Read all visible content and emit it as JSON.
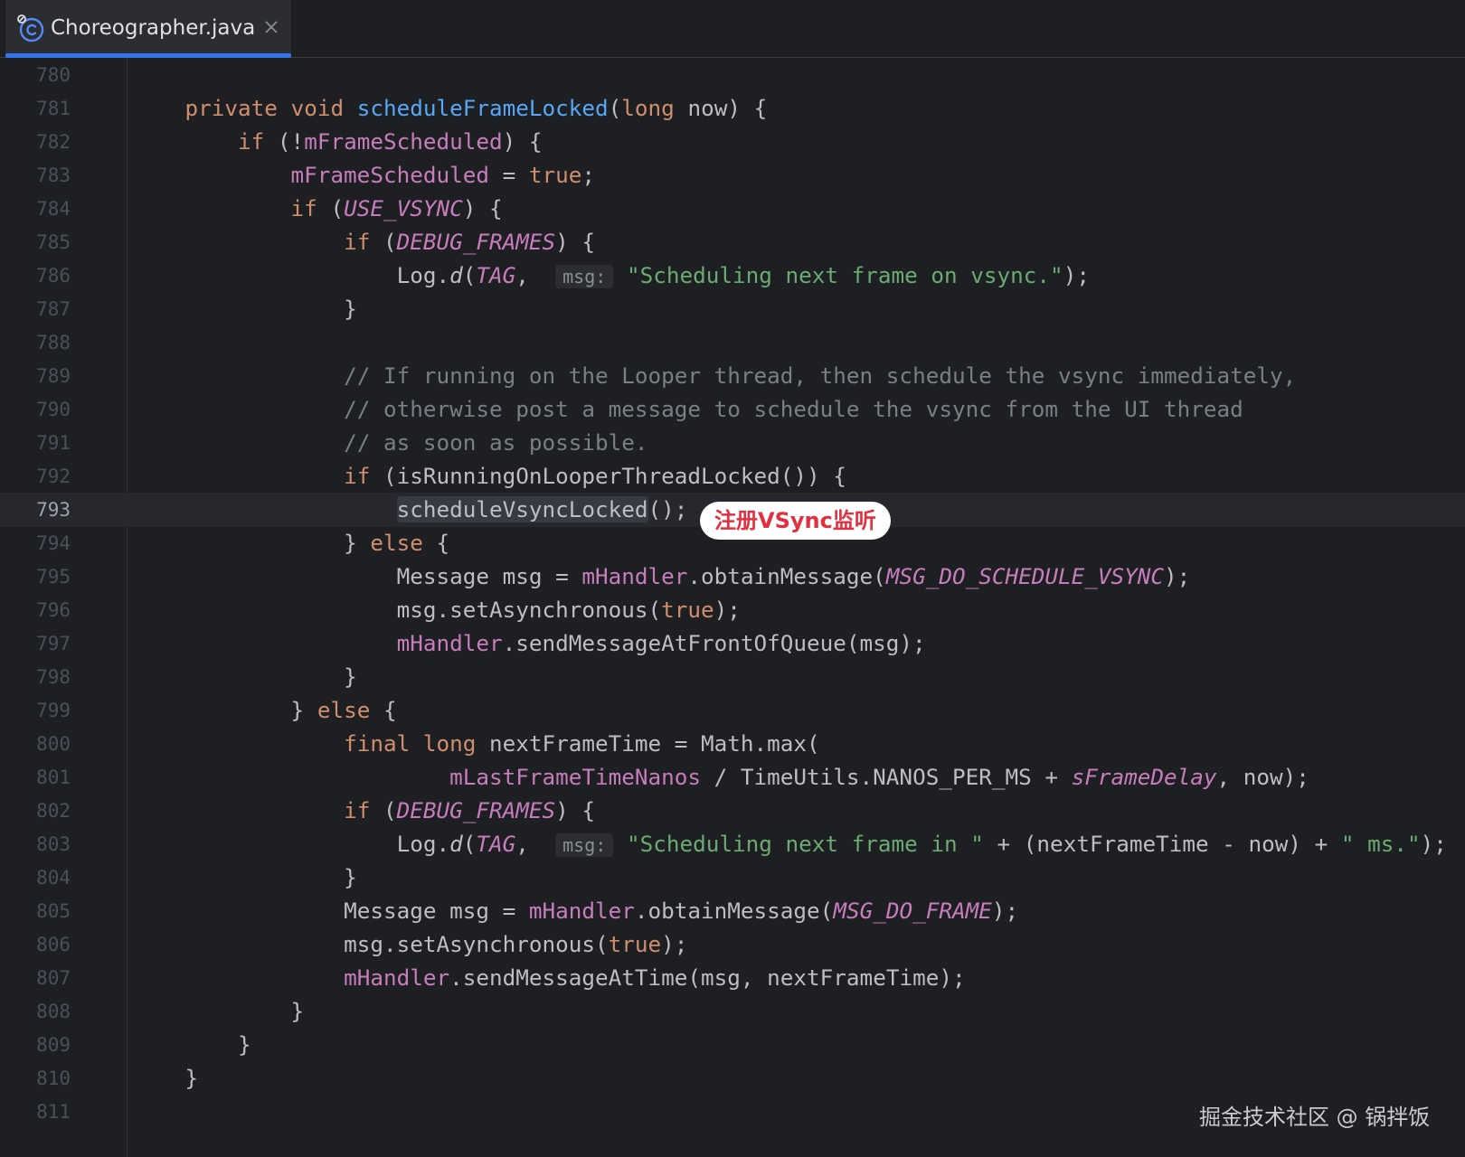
{
  "tab": {
    "title": "Choreographer.java",
    "icon": "java-class-icon",
    "close_icon": "close-icon",
    "active_color": "#3574f0"
  },
  "editor": {
    "current_line": "793",
    "lines": [
      {
        "num": "780",
        "indent": "",
        "tokens": []
      },
      {
        "num": "781",
        "indent": "    ",
        "tokens": [
          {
            "t": "private",
            "c": "kw"
          },
          {
            "t": " "
          },
          {
            "t": "void",
            "c": "kw"
          },
          {
            "t": " "
          },
          {
            "t": "scheduleFrameLocked",
            "c": "fn"
          },
          {
            "t": "("
          },
          {
            "t": "long",
            "c": "kw"
          },
          {
            "t": " now) {"
          }
        ]
      },
      {
        "num": "782",
        "indent": "        ",
        "tokens": [
          {
            "t": "if",
            "c": "kw"
          },
          {
            "t": " (!"
          },
          {
            "t": "mFrameScheduled",
            "c": "field"
          },
          {
            "t": ") {"
          }
        ]
      },
      {
        "num": "783",
        "indent": "            ",
        "tokens": [
          {
            "t": "mFrameScheduled",
            "c": "field"
          },
          {
            "t": " = "
          },
          {
            "t": "true",
            "c": "kw"
          },
          {
            "t": ";"
          }
        ]
      },
      {
        "num": "784",
        "indent": "            ",
        "tokens": [
          {
            "t": "if",
            "c": "kw"
          },
          {
            "t": " ("
          },
          {
            "t": "USE_VSYNC",
            "c": "const"
          },
          {
            "t": ") {"
          }
        ]
      },
      {
        "num": "785",
        "indent": "                ",
        "tokens": [
          {
            "t": "if",
            "c": "kw"
          },
          {
            "t": " ("
          },
          {
            "t": "DEBUG_FRAMES",
            "c": "const"
          },
          {
            "t": ") {"
          }
        ]
      },
      {
        "num": "786",
        "indent": "                    ",
        "tokens": [
          {
            "t": "Log."
          },
          {
            "t": "d",
            "c": "it"
          },
          {
            "t": "("
          },
          {
            "t": "TAG",
            "c": "const"
          },
          {
            "t": ",  "
          },
          {
            "t": "msg:",
            "c": "hint"
          },
          {
            "t": " "
          },
          {
            "t": "\"Scheduling next frame on vsync.\"",
            "c": "str"
          },
          {
            "t": ");"
          }
        ]
      },
      {
        "num": "787",
        "indent": "                ",
        "tokens": [
          {
            "t": "}"
          }
        ]
      },
      {
        "num": "788",
        "indent": "",
        "tokens": []
      },
      {
        "num": "789",
        "indent": "                ",
        "tokens": [
          {
            "t": "// If running on the Looper thread, then schedule the vsync immediately,",
            "c": "cmt"
          }
        ]
      },
      {
        "num": "790",
        "indent": "                ",
        "tokens": [
          {
            "t": "// otherwise post a message to schedule the vsync from the UI thread",
            "c": "cmt"
          }
        ]
      },
      {
        "num": "791",
        "indent": "                ",
        "tokens": [
          {
            "t": "// as soon as possible.",
            "c": "cmt"
          }
        ]
      },
      {
        "num": "792",
        "indent": "                ",
        "tokens": [
          {
            "t": "if",
            "c": "kw"
          },
          {
            "t": " (isRunningOnLooperThreadLocked()) {"
          }
        ]
      },
      {
        "num": "793",
        "indent": "                    ",
        "tokens": [
          {
            "t": "scheduleVsyncLocked",
            "c": "hl"
          },
          {
            "t": "();"
          }
        ]
      },
      {
        "num": "794",
        "indent": "                ",
        "tokens": [
          {
            "t": "} "
          },
          {
            "t": "else",
            "c": "kw"
          },
          {
            "t": " {"
          }
        ]
      },
      {
        "num": "795",
        "indent": "                    ",
        "tokens": [
          {
            "t": "Message msg = "
          },
          {
            "t": "mHandler",
            "c": "field"
          },
          {
            "t": ".obtainMessage("
          },
          {
            "t": "MSG_DO_SCHEDULE_VSYNC",
            "c": "const"
          },
          {
            "t": ");"
          }
        ]
      },
      {
        "num": "796",
        "indent": "                    ",
        "tokens": [
          {
            "t": "msg.setAsynchronous("
          },
          {
            "t": "true",
            "c": "kw"
          },
          {
            "t": ");"
          }
        ]
      },
      {
        "num": "797",
        "indent": "                    ",
        "tokens": [
          {
            "t": "mHandler",
            "c": "field"
          },
          {
            "t": ".sendMessageAtFrontOfQueue(msg);"
          }
        ]
      },
      {
        "num": "798",
        "indent": "                ",
        "tokens": [
          {
            "t": "}"
          }
        ]
      },
      {
        "num": "799",
        "indent": "            ",
        "tokens": [
          {
            "t": "} "
          },
          {
            "t": "else",
            "c": "kw"
          },
          {
            "t": " {"
          }
        ]
      },
      {
        "num": "800",
        "indent": "                ",
        "tokens": [
          {
            "t": "final",
            "c": "kw"
          },
          {
            "t": " "
          },
          {
            "t": "long",
            "c": "kw"
          },
          {
            "t": " nextFrameTime = Math.max("
          }
        ]
      },
      {
        "num": "801",
        "indent": "                        ",
        "tokens": [
          {
            "t": "mLastFrameTimeNanos",
            "c": "field"
          },
          {
            "t": " / TimeUtils.NANOS_PER_MS + "
          },
          {
            "t": "sFrameDelay",
            "c": "stfield"
          },
          {
            "t": ", now);"
          }
        ]
      },
      {
        "num": "802",
        "indent": "                ",
        "tokens": [
          {
            "t": "if",
            "c": "kw"
          },
          {
            "t": " ("
          },
          {
            "t": "DEBUG_FRAMES",
            "c": "const"
          },
          {
            "t": ") {"
          }
        ]
      },
      {
        "num": "803",
        "indent": "                    ",
        "tokens": [
          {
            "t": "Log."
          },
          {
            "t": "d",
            "c": "it"
          },
          {
            "t": "("
          },
          {
            "t": "TAG",
            "c": "const"
          },
          {
            "t": ",  "
          },
          {
            "t": "msg:",
            "c": "hint"
          },
          {
            "t": " "
          },
          {
            "t": "\"Scheduling next frame in \"",
            "c": "str"
          },
          {
            "t": " + (nextFrameTime - now) + "
          },
          {
            "t": "\" ms.\"",
            "c": "str"
          },
          {
            "t": ");"
          }
        ]
      },
      {
        "num": "804",
        "indent": "                ",
        "tokens": [
          {
            "t": "}"
          }
        ]
      },
      {
        "num": "805",
        "indent": "                ",
        "tokens": [
          {
            "t": "Message msg = "
          },
          {
            "t": "mHandler",
            "c": "field"
          },
          {
            "t": ".obtainMessage("
          },
          {
            "t": "MSG_DO_FRAME",
            "c": "const"
          },
          {
            "t": ");"
          }
        ]
      },
      {
        "num": "806",
        "indent": "                ",
        "tokens": [
          {
            "t": "msg.setAsynchronous("
          },
          {
            "t": "true",
            "c": "kw"
          },
          {
            "t": ");"
          }
        ]
      },
      {
        "num": "807",
        "indent": "                ",
        "tokens": [
          {
            "t": "mHandler",
            "c": "field"
          },
          {
            "t": ".sendMessageAtTime(msg, nextFrameTime);"
          }
        ]
      },
      {
        "num": "808",
        "indent": "            ",
        "tokens": [
          {
            "t": "}"
          }
        ]
      },
      {
        "num": "809",
        "indent": "        ",
        "tokens": [
          {
            "t": "}"
          }
        ]
      },
      {
        "num": "810",
        "indent": "    ",
        "tokens": [
          {
            "t": "}"
          }
        ]
      },
      {
        "num": "811",
        "indent": "",
        "tokens": []
      }
    ]
  },
  "annotation": {
    "text": "注册VSync监听",
    "color": "#e33040"
  },
  "watermark": {
    "text": "掘金技术社区 @ 锅拌饭"
  },
  "colors": {
    "background": "#1e1f22",
    "keyword": "#cf8e6d",
    "function": "#56a8f5",
    "field": "#c77dbb",
    "string": "#6aab73",
    "comment": "#7a7e85",
    "text": "#bcbec4"
  }
}
